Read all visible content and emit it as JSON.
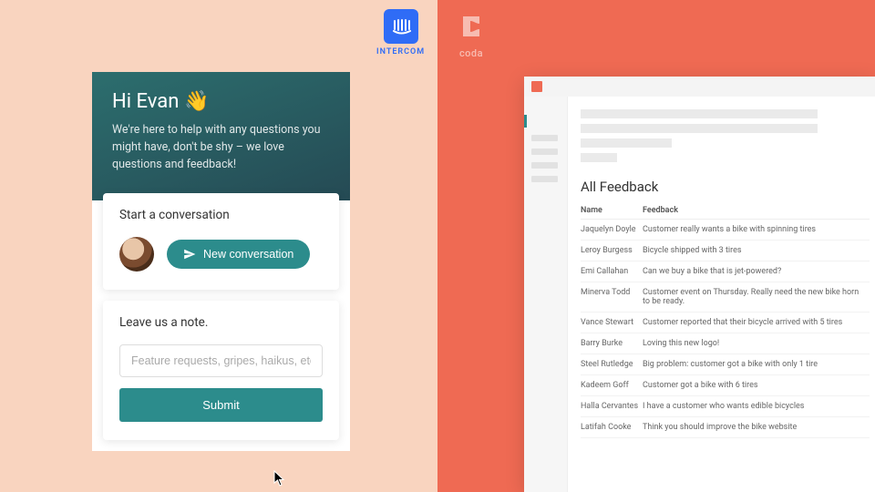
{
  "brands": {
    "intercom": {
      "label": "INTERCOM"
    },
    "coda": {
      "label": "coda"
    }
  },
  "intercom": {
    "greeting": "Hi Evan",
    "subtext": "We're here to help with any questions you might have, don't be shy – we love questions and feedback!",
    "start_card": {
      "title": "Start a conversation",
      "new_conversation_label": "New conversation"
    },
    "note_card": {
      "title": "Leave us a note.",
      "placeholder": "Feature requests, gripes, haikus, etc.",
      "submit_label": "Submit"
    }
  },
  "coda": {
    "feedback_title": "All Feedback",
    "columns": {
      "name": "Name",
      "feedback": "Feedback"
    },
    "rows": [
      {
        "name": "Jaquelyn Doyle",
        "feedback": "Customer really wants a bike with spinning tires"
      },
      {
        "name": "Leroy Burgess",
        "feedback": "Bicycle shipped with 3 tires"
      },
      {
        "name": "Emi Callahan",
        "feedback": "Can we buy a bike that is jet-powered?"
      },
      {
        "name": "Minerva Todd",
        "feedback": "Customer event on Thursday. Really need the new bike horn to be ready."
      },
      {
        "name": "Vance Stewart",
        "feedback": "Customer reported that their bicycle arrived with 5 tires"
      },
      {
        "name": "Barry Burke",
        "feedback": "Loving this new logo!"
      },
      {
        "name": "Steel Rutledge",
        "feedback": "Big problem: customer got a bike with only 1 tire"
      },
      {
        "name": "Kadeem Goff",
        "feedback": "Customer got a bike with 6 tires"
      },
      {
        "name": "Halla Cervantes",
        "feedback": "I have a customer who wants edible bicycles"
      },
      {
        "name": "Latifah Cooke",
        "feedback": "Think you should improve the bike website"
      }
    ]
  }
}
